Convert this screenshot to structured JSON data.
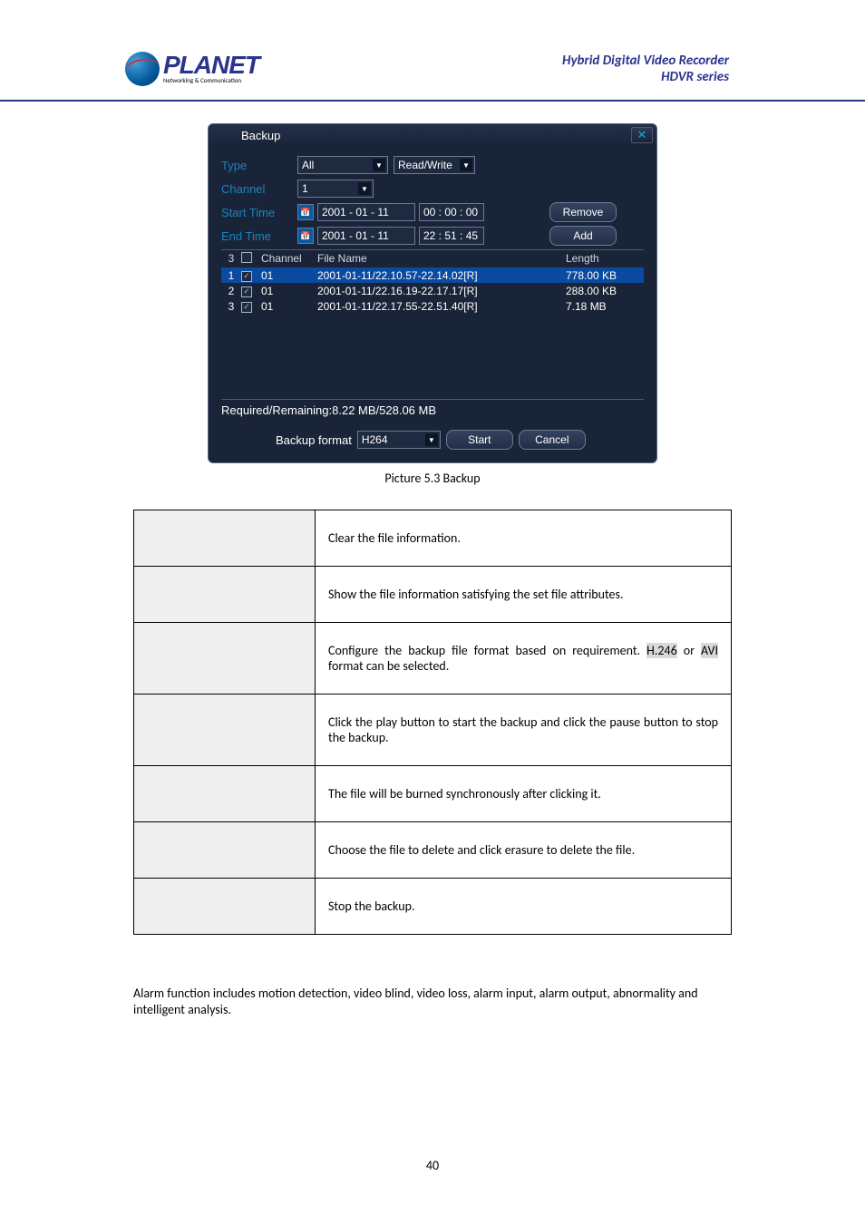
{
  "header": {
    "logo_text": "PLANET",
    "logo_sub": "Networking & Communication",
    "title1": "Hybrid Digital Video Recorder",
    "title2": "HDVR series"
  },
  "backup": {
    "title": "Backup",
    "labels": {
      "type": "Type",
      "channel": "Channel",
      "start_time": "Start Time",
      "end_time": "End Time",
      "backup_format": "Backup format",
      "required_remaining": "Required/Remaining:8.22 MB/528.06 MB"
    },
    "selects": {
      "type_value": "All",
      "rw_value": "Read/Write",
      "channel_value": "1",
      "format_value": "H264"
    },
    "start_date": "2001 - 01 - 11",
    "start_time": "00 : 00 : 00",
    "end_date": "2001 - 01 - 11",
    "end_time": "22 : 51 : 45",
    "buttons": {
      "remove": "Remove",
      "add": "Add",
      "start": "Start",
      "cancel": "Cancel"
    },
    "list_headers": {
      "count": "3",
      "channel": "Channel",
      "file_name": "File Name",
      "length": "Length"
    },
    "rows": [
      {
        "n": "1",
        "ch": "01",
        "fn": "2001-01-11/22.10.57-22.14.02[R]",
        "len": "778.00 KB"
      },
      {
        "n": "2",
        "ch": "01",
        "fn": "2001-01-11/22.16.19-22.17.17[R]",
        "len": "288.00 KB"
      },
      {
        "n": "3",
        "ch": "01",
        "fn": "2001-01-11/22.17.55-22.51.40[R]",
        "len": "7.18 MB"
      }
    ]
  },
  "caption": "Picture 5.3 Backup",
  "table": {
    "r1": "Clear the file information.",
    "r2": "Show the file information satisfying the set file attributes.",
    "r3a": "Configure the backup file format based on requirement. ",
    "r3_h246": "H.246",
    "r3b": " or ",
    "r3_avi": "AVI",
    "r3c": " format can be selected.",
    "r4": "Click the play button to start the backup and click the pause button to stop the backup.",
    "r5": "The file will be burned synchronously after clicking it.",
    "r6": "Choose the file to delete and click erasure to delete the file.",
    "r7": "Stop the backup."
  },
  "paragraph": "Alarm function includes motion detection, video blind, video loss, alarm input, alarm output, abnormality and intelligent analysis.",
  "page_number": "40"
}
